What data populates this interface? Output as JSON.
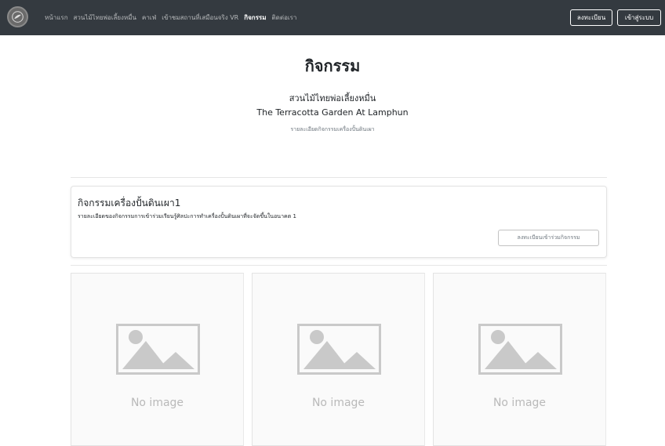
{
  "navbar": {
    "links": [
      {
        "label": "หน้าแรก"
      },
      {
        "label": "สวนไม้ไทยพ่อเลี้ยงหมื่น"
      },
      {
        "label": "คาเฟ่"
      },
      {
        "label": "เข้าชมสถานที่เสมือนจริง VR"
      },
      {
        "label": "กิจกรรม",
        "active": true
      },
      {
        "label": "ติดต่อเรา"
      }
    ],
    "register_label": "ลงทะเบียน",
    "login_label": "เข้าสู่ระบบ",
    "logo_icon": "garden-logo-icon"
  },
  "header": {
    "title": "กิจกรรม",
    "subtitle_th": "สวนไม้ไทยพ่อเลี้ยงหมื่น",
    "subtitle_en": "The Terracotta Garden At Lamphun",
    "description": "รายละเอียดกิจกรรมเครื่องปั้นดินเผา"
  },
  "activity": {
    "title": "กิจกรรมเครื่องปั้นดินเผา1",
    "description": "รายละเอียดของกิจกรรมการเข้าร่วมเรียนรู้ศิลปะการทำเครื่องปั้นดินเผาที่จะจัดขึ้นในอนาคต 1",
    "join_button": "ลงทะเบียนเข้าร่วมกิจกรรม"
  },
  "gallery": {
    "items": [
      {
        "label": "No image",
        "icon": "image-placeholder-icon"
      },
      {
        "label": "No image",
        "icon": "image-placeholder-icon"
      },
      {
        "label": "No image",
        "icon": "image-placeholder-icon"
      }
    ]
  },
  "colors": {
    "navbar_bg": "#343a40",
    "placeholder_gray": "#c9c9c9"
  }
}
